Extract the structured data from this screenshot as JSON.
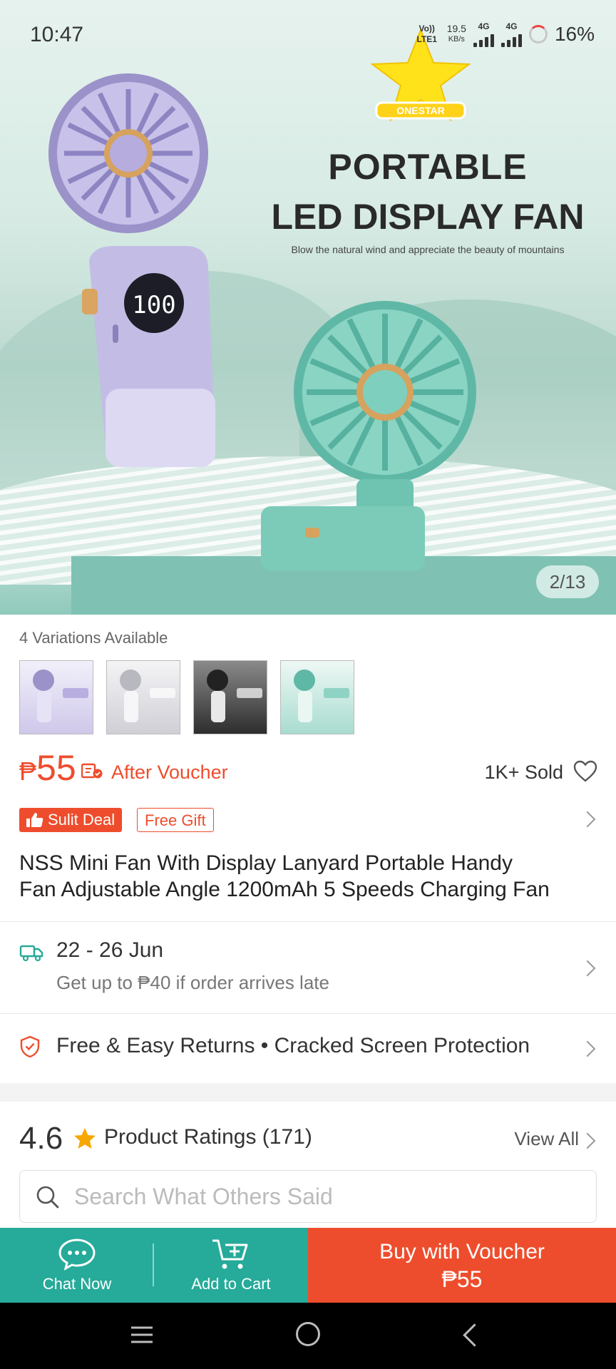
{
  "status_bar": {
    "time": "10:47",
    "volte": "Vo)) LTE1",
    "speed_value": "19.5",
    "speed_unit": "KB/s",
    "net1": "4G",
    "net2": "4G",
    "battery": "16%"
  },
  "hero": {
    "brand_logo": "ONESTAR",
    "title_line1": "PORTABLE",
    "title_line2": "LED DISPLAY FAN",
    "tagline": "Blow the natural wind and appreciate the beauty of mountains",
    "display_readout": "100",
    "pager": "2/13"
  },
  "variations": {
    "label": "4 Variations Available",
    "thumbs": [
      {
        "name": "purple",
        "color": "#b9aee0"
      },
      {
        "name": "white",
        "color": "#d7d7dc"
      },
      {
        "name": "black",
        "color": "#3a3a3a"
      },
      {
        "name": "green",
        "color": "#8fd3c4"
      }
    ]
  },
  "price": {
    "currency": "₱",
    "value": "55",
    "after_voucher": "After Voucher",
    "sold": "1K+ Sold"
  },
  "badges": {
    "sulit": "Sulit Deal",
    "gift": "Free Gift"
  },
  "product": {
    "title_line1": "NSS Mini Fan With Display Lanyard Portable Handy",
    "title_line2": "Fan Adjustable Angle 1200mAh 5 Speeds Charging Fan"
  },
  "shipping": {
    "date_range": "22 - 26 Jun",
    "late_note": "Get up to ₱40 if order arrives late"
  },
  "returns": {
    "text": "Free & Easy Returns  •  Cracked Screen Protection"
  },
  "ratings": {
    "score": "4.6",
    "label": "Product Ratings (171)",
    "view_all": "View All",
    "search_placeholder": "Search What Others Said"
  },
  "bottom_bar": {
    "chat": "Chat Now",
    "cart": "Add to Cart",
    "buy_line1": "Buy with Voucher",
    "buy_line2": "₱55"
  },
  "colors": {
    "brand_orange": "#ee4d2d",
    "teal": "#26aa99",
    "star": "#f6a700"
  }
}
